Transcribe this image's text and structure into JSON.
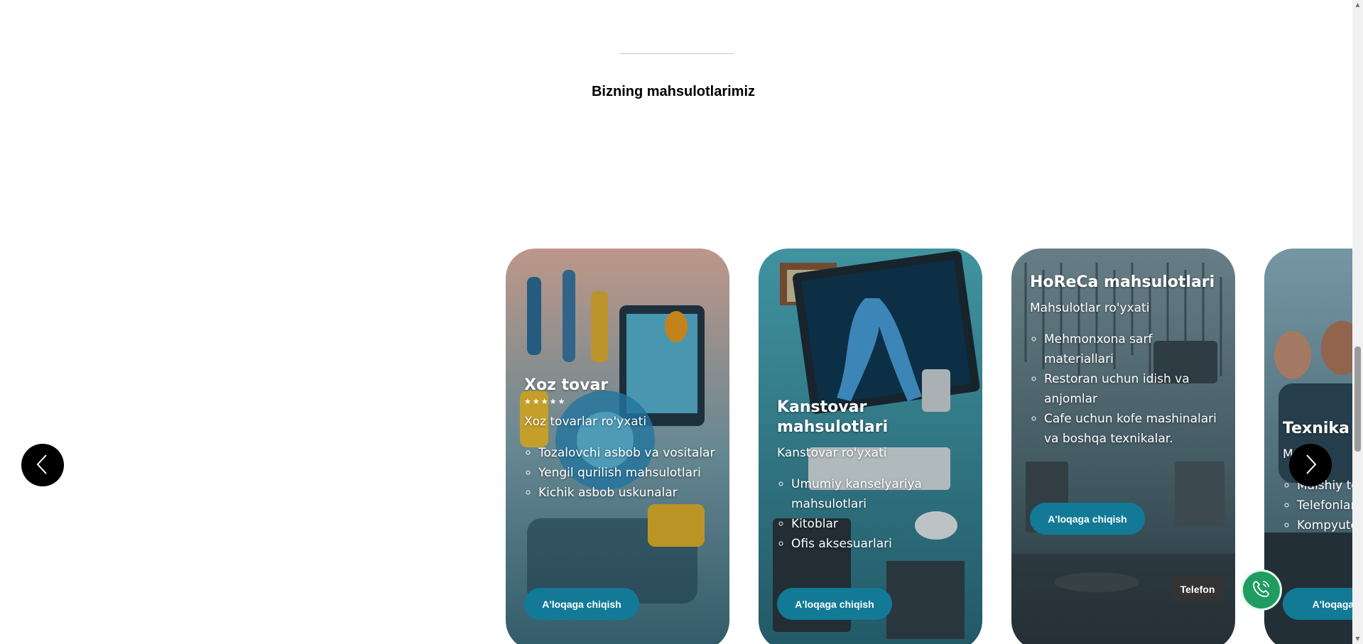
{
  "section": {
    "title": "Bizning mahsulotlarimiz"
  },
  "cards": [
    {
      "title": "Xoz tovar",
      "stars": "★★★★★",
      "subtitle": "Xoz tovarlar ro'yxati",
      "items": [
        "Tozalovchi asbob va vositalar",
        "Yengil qurilish mahsulotlari",
        "Kichik asbob uskunalar"
      ],
      "button": "A'loqaga chiqish"
    },
    {
      "title": "Kanstovar mahsulotlari",
      "subtitle": "Kanstovar ro'yxati",
      "items": [
        "Umumiy kanselyariya mahsulotlari",
        "Kitoblar",
        "Ofis aksesuarlari"
      ],
      "button": "A'loqaga chiqish"
    },
    {
      "title": "HoReCa mahsulotlari",
      "subtitle": "Mahsulotlar ro'yxati",
      "items": [
        "Mehmonxona sarf materiallari",
        "Restoran uchun idish va anjomlar",
        "Cafe uchun kofe mashinalari va boshqa texnikalar."
      ],
      "button": "A'loqaga chiqish"
    },
    {
      "title": "Texnika m",
      "subtitle": "Ma   t ro",
      "items": [
        "Maishiy te",
        "Telefonlar",
        "Kompyute"
      ],
      "button": "A'loqaga ch"
    }
  ],
  "contact": {
    "phone_label": "Telefon"
  },
  "colors": {
    "button": "#127a96",
    "phone": "#1f9c5f",
    "arrow": "#000000"
  },
  "icons": {
    "prev": "chevron-left-icon",
    "next": "chevron-right-icon",
    "phone": "phone-ringing-icon"
  }
}
